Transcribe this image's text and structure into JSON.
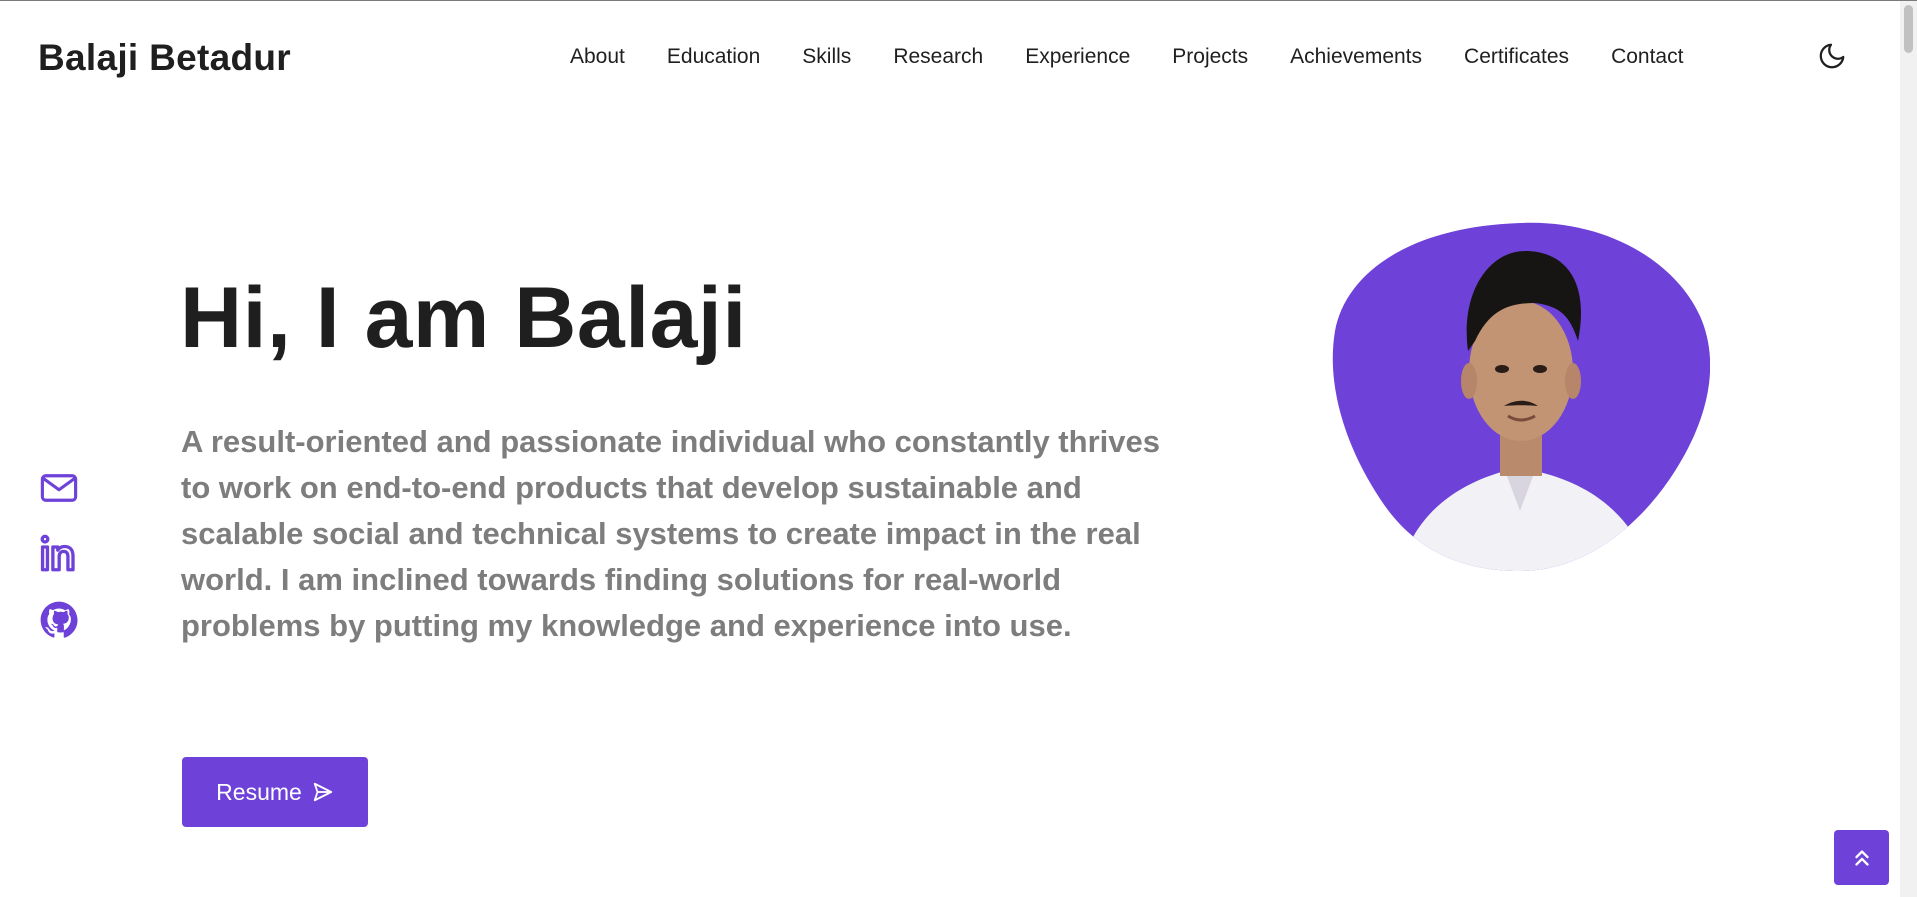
{
  "brand": {
    "name": "Balaji Betadur"
  },
  "nav": {
    "items": [
      {
        "label": "About"
      },
      {
        "label": "Education"
      },
      {
        "label": "Skills"
      },
      {
        "label": "Research"
      },
      {
        "label": "Experience"
      },
      {
        "label": "Projects"
      },
      {
        "label": "Achievements"
      },
      {
        "label": "Certificates"
      },
      {
        "label": "Contact"
      }
    ],
    "theme_toggle_icon": "moon-icon"
  },
  "hero": {
    "title": "Hi, I am Balaji",
    "description": "A result-oriented and passionate individual who constantly thrives to work on end-to-end products that develop sustainable and scalable social and technical systems to create impact in the real world. I am inclined towards finding solutions for real-world problems by putting my knowledge and experience into use.",
    "resume_button": {
      "label": "Resume",
      "icon": "send-icon"
    }
  },
  "social": [
    {
      "icon": "mail-icon"
    },
    {
      "icon": "linkedin-icon"
    },
    {
      "icon": "github-icon"
    }
  ],
  "scroll_top": {
    "icon": "double-chevron-up-icon"
  },
  "colors": {
    "accent": "#6e42d9",
    "text_dark": "#1f1f1f",
    "text_muted": "#7d7d7d",
    "background": "#ffffff"
  }
}
